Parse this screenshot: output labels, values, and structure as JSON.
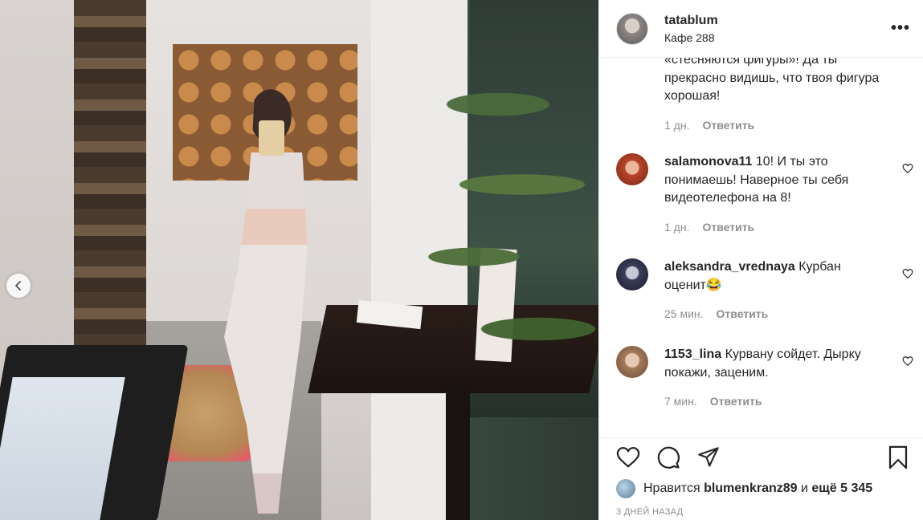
{
  "post": {
    "username": "tatablum",
    "location": "Кафе 288",
    "more_label": "•••"
  },
  "comments": [
    {
      "text": "«стесняются фигуры»! Да ты прекрасно видишь, что твоя фигура хорошая!",
      "time": "1 дн.",
      "reply": "Ответить"
    },
    {
      "user": "salamonova11",
      "text": "10! И ты это понимаешь! Наверное ты себя видеотелефона на 8!",
      "time": "1 дн.",
      "reply": "Ответить"
    },
    {
      "user": "aleksandra_vrednaya",
      "text": "Курбан оценит😂",
      "time": "25 мин.",
      "reply": "Ответить"
    },
    {
      "user": "1153_lina",
      "text": "Курвану сойдет. Дырку покажи, заценим.",
      "time": "7 мин.",
      "reply": "Ответить"
    }
  ],
  "likes": {
    "prefix": "Нравится",
    "user": "blumenkranz89",
    "middle": "и",
    "others": "ещё 5 345"
  },
  "timestamp": "3 ДНЕЙ НАЗАД",
  "icons": {
    "heart": "heart-icon",
    "comment": "comment-icon",
    "share": "share-icon",
    "bookmark": "bookmark-icon",
    "prev": "chevron-left-icon"
  }
}
